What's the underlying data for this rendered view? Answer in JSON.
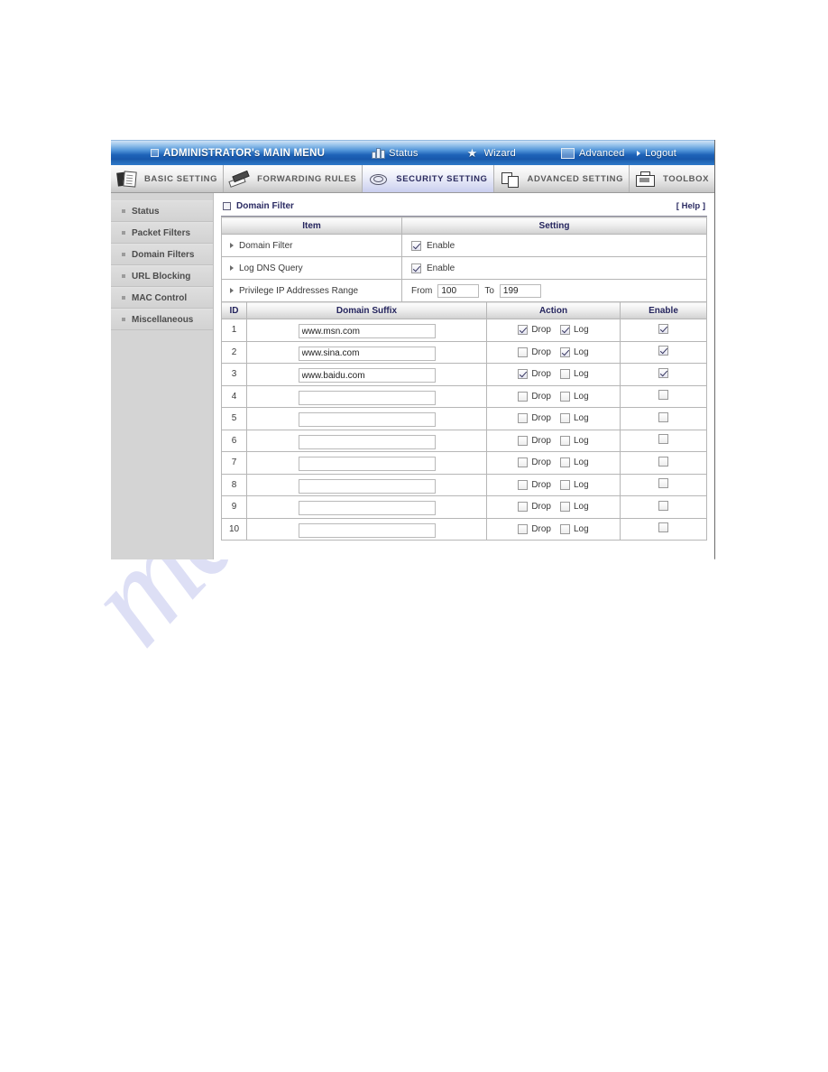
{
  "watermark": {
    "text": "manualshive.com"
  },
  "topbar": {
    "admin_label": "ADMINISTRATOR's MAIN MENU",
    "status_label": "Status",
    "wizard_label": "Wizard",
    "advanced_label": "Advanced",
    "logout_label": "Logout"
  },
  "tabs": [
    {
      "label": "BASIC SETTING",
      "active": false
    },
    {
      "label": "FORWARDING RULES",
      "active": false
    },
    {
      "label": "SECURITY SETTING",
      "active": true
    },
    {
      "label": "ADVANCED SETTING",
      "active": false
    },
    {
      "label": "TOOLBOX",
      "active": false
    }
  ],
  "sidebar": {
    "items": [
      {
        "label": "Status"
      },
      {
        "label": "Packet Filters"
      },
      {
        "label": "Domain Filters"
      },
      {
        "label": "URL Blocking"
      },
      {
        "label": "MAC Control"
      },
      {
        "label": "Miscellaneous"
      }
    ]
  },
  "panel": {
    "title": "Domain Filter",
    "help_label": "[ Help ]",
    "settings_header": {
      "item": "Item",
      "setting": "Setting"
    },
    "rows": [
      {
        "label": "Domain Filter",
        "enable_label": "Enable",
        "checked": true
      },
      {
        "label": "Log DNS Query",
        "enable_label": "Enable",
        "checked": true
      }
    ],
    "privilege": {
      "label": "Privilege IP Addresses Range",
      "from_label": "From",
      "from_value": "100",
      "to_label": "To",
      "to_value": "199"
    }
  },
  "filter_table": {
    "headers": {
      "id": "ID",
      "domain": "Domain Suffix",
      "action": "Action",
      "enable": "Enable"
    },
    "action_labels": {
      "drop": "Drop",
      "log": "Log"
    },
    "rows": [
      {
        "id": "1",
        "domain": "www.msn.com",
        "drop": true,
        "log": true,
        "enable": true
      },
      {
        "id": "2",
        "domain": "www.sina.com",
        "drop": false,
        "log": true,
        "enable": true
      },
      {
        "id": "3",
        "domain": "www.baidu.com",
        "drop": true,
        "log": false,
        "enable": true
      },
      {
        "id": "4",
        "domain": "",
        "drop": false,
        "log": false,
        "enable": false
      },
      {
        "id": "5",
        "domain": "",
        "drop": false,
        "log": false,
        "enable": false
      },
      {
        "id": "6",
        "domain": "",
        "drop": false,
        "log": false,
        "enable": false
      },
      {
        "id": "7",
        "domain": "",
        "drop": false,
        "log": false,
        "enable": false
      },
      {
        "id": "8",
        "domain": "",
        "drop": false,
        "log": false,
        "enable": false
      },
      {
        "id": "9",
        "domain": "",
        "drop": false,
        "log": false,
        "enable": false
      },
      {
        "id": "10",
        "domain": "",
        "drop": false,
        "log": false,
        "enable": false
      }
    ]
  }
}
